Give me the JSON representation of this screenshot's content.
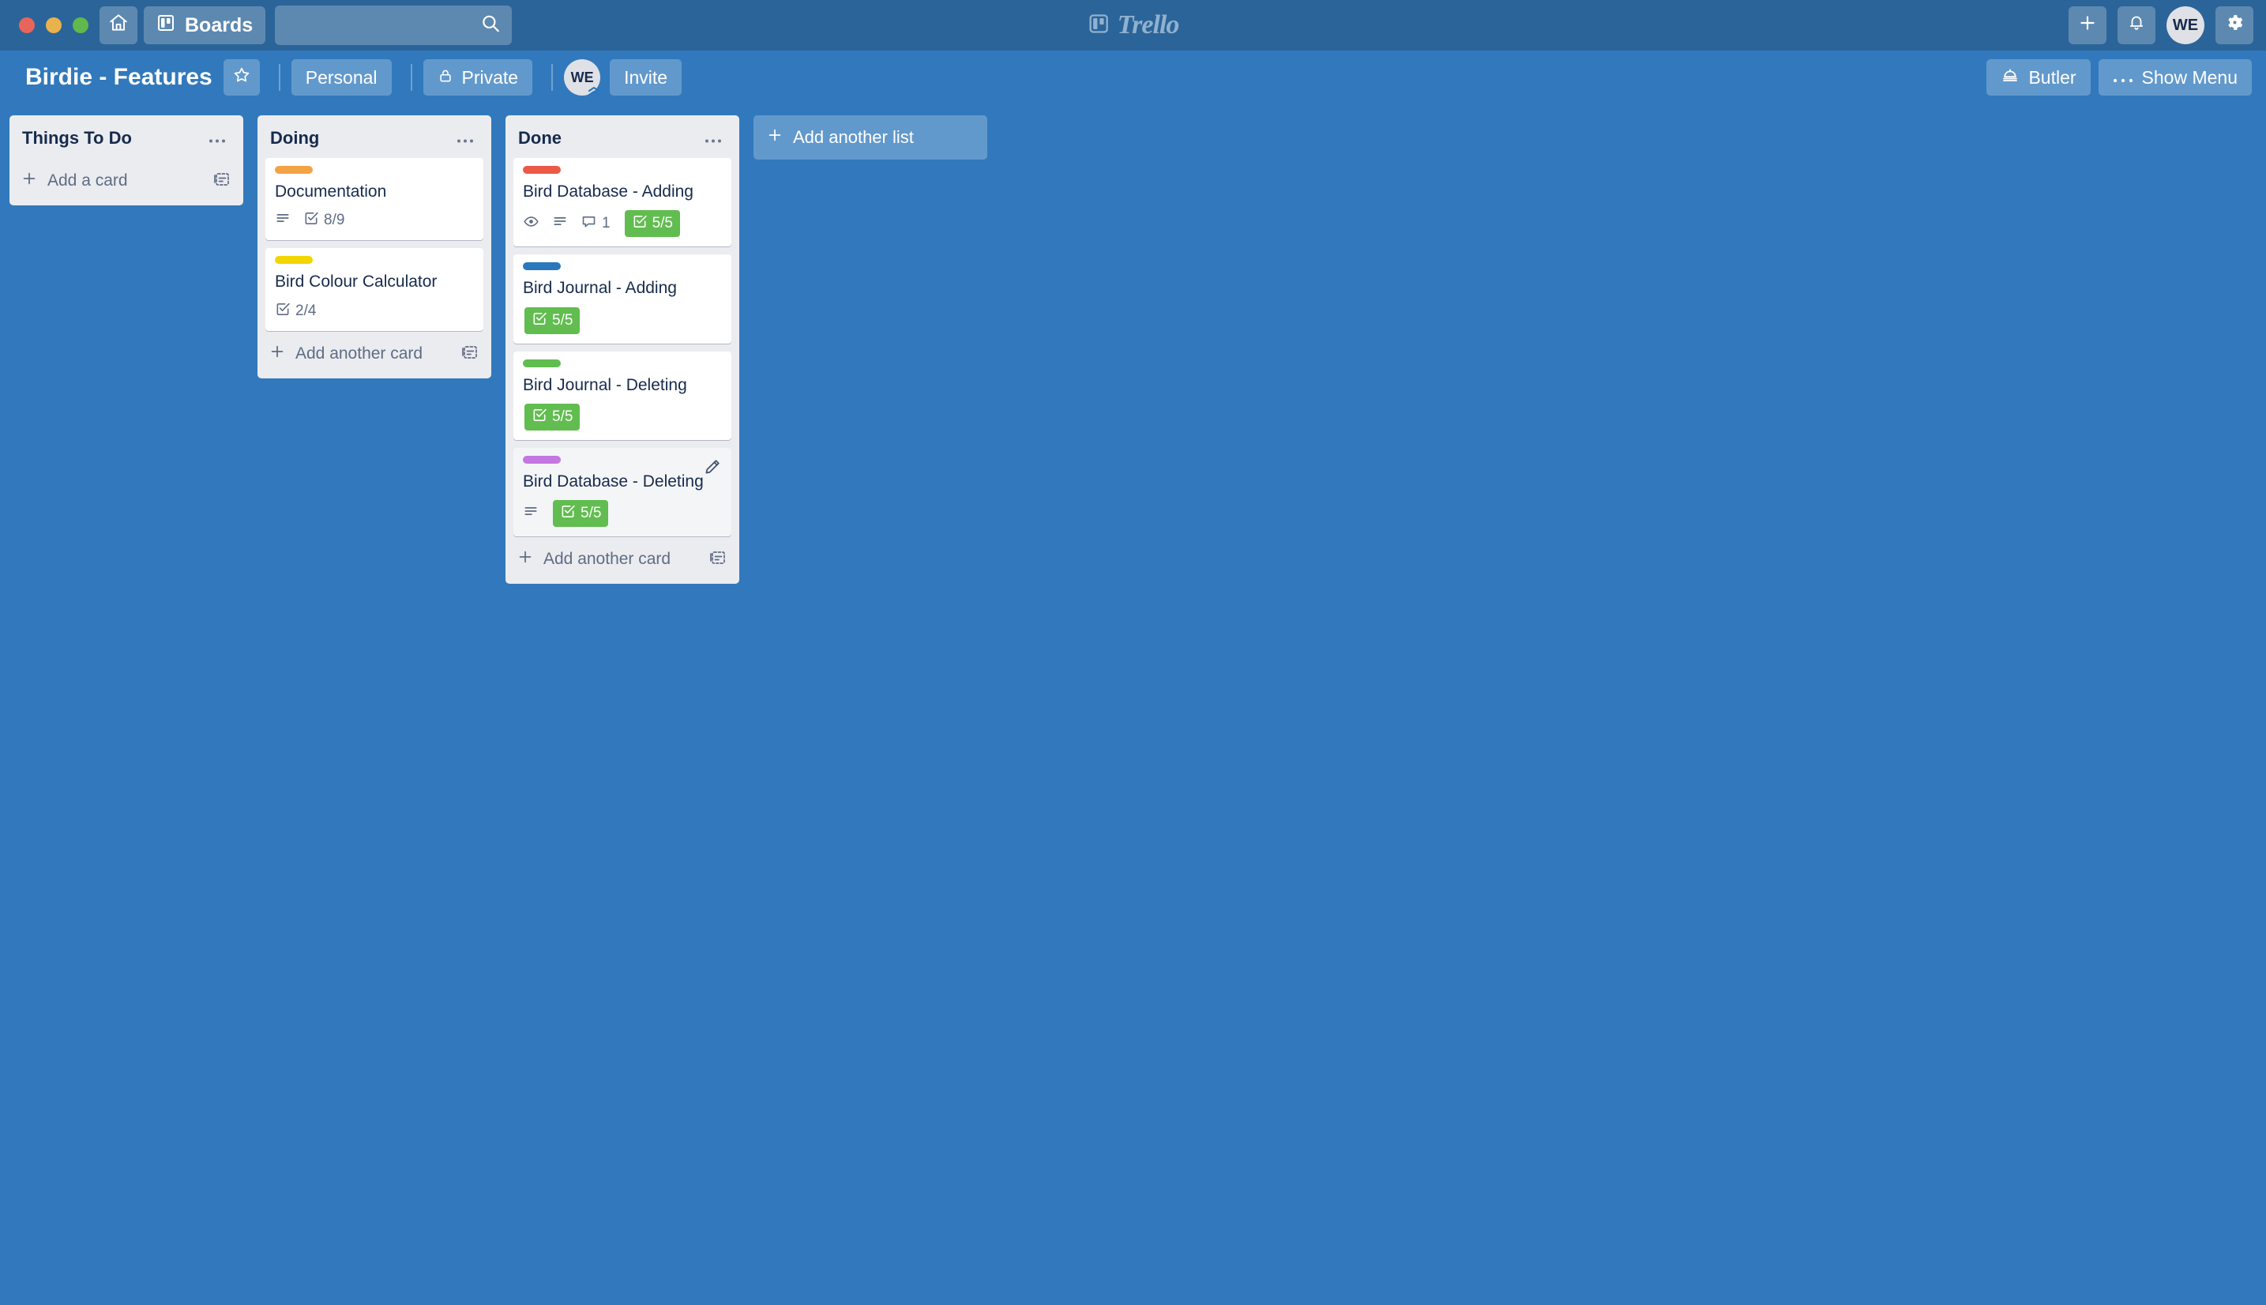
{
  "topbar": {
    "home_icon": "home-icon",
    "boards_label": "Boards",
    "boards_icon": "board-icon",
    "search": {
      "value": "",
      "placeholder": ""
    },
    "search_icon": "search-icon",
    "logo_text": "Trello",
    "logo_icon": "trello-board-icon",
    "add_icon": "plus-icon",
    "notifications_icon": "bell-icon",
    "avatar_initials": "WE",
    "settings_icon": "gear-icon"
  },
  "boardbar": {
    "title": "Birdie - Features",
    "star_icon": "star-icon",
    "team_label": "Personal",
    "visibility_label": "Private",
    "visibility_icon": "lock-icon",
    "member_initials": "WE",
    "invite_label": "Invite",
    "butler_label": "Butler",
    "butler_icon": "butler-bell-icon",
    "show_menu_label": "Show Menu",
    "show_menu_icon": "ellipsis-icon"
  },
  "canvas": {
    "add_list_label": "Add another list",
    "add_list_icon": "plus-icon",
    "lists": [
      {
        "title": "Things To Do",
        "menu_icon": "ellipsis-icon",
        "add_card_label": "Add a card",
        "add_card_icon": "plus-icon",
        "template_icon": "card-template-icon",
        "cards": []
      },
      {
        "title": "Doing",
        "menu_icon": "ellipsis-icon",
        "add_card_label": "Add another card",
        "add_card_icon": "plus-icon",
        "template_icon": "card-template-icon",
        "cards": [
          {
            "title": "Documentation",
            "label_color": "#f2a345",
            "hover": false,
            "badges": [
              {
                "kind": "description",
                "icon": "description-icon",
                "text": ""
              },
              {
                "kind": "checklist",
                "icon": "checklist-icon",
                "text": "8/9",
                "complete": false
              }
            ]
          },
          {
            "title": "Bird Colour Calculator",
            "label_color": "#f2d600",
            "hover": false,
            "badges": [
              {
                "kind": "checklist",
                "icon": "checklist-icon",
                "text": "2/4",
                "complete": false
              }
            ]
          }
        ]
      },
      {
        "title": "Done",
        "menu_icon": "ellipsis-icon",
        "add_card_label": "Add another card",
        "add_card_icon": "plus-icon",
        "template_icon": "card-template-icon",
        "cards": [
          {
            "title": "Bird Database - Adding",
            "label_color": "#eb5a46",
            "hover": false,
            "badges": [
              {
                "kind": "watch",
                "icon": "eye-icon",
                "text": ""
              },
              {
                "kind": "description",
                "icon": "description-icon",
                "text": ""
              },
              {
                "kind": "comments",
                "icon": "comment-icon",
                "text": "1"
              },
              {
                "kind": "checklist",
                "icon": "checklist-icon",
                "text": "5/5",
                "complete": true
              }
            ]
          },
          {
            "title": "Bird Journal - Adding",
            "label_color": "#2a77bd",
            "hover": false,
            "badges": [
              {
                "kind": "checklist",
                "icon": "checklist-icon",
                "text": "5/5",
                "complete": true
              }
            ]
          },
          {
            "title": "Bird Journal - Deleting",
            "label_color": "#61bd4f",
            "hover": false,
            "badges": [
              {
                "kind": "checklist",
                "icon": "checklist-icon",
                "text": "5/5",
                "complete": true
              }
            ]
          },
          {
            "title": "Bird Database - Deleting",
            "label_color": "#c377e0",
            "hover": true,
            "edit_icon": "pencil-icon",
            "badges": [
              {
                "kind": "description",
                "icon": "description-icon",
                "text": ""
              },
              {
                "kind": "checklist",
                "icon": "checklist-icon",
                "text": "5/5",
                "complete": true
              }
            ]
          }
        ]
      }
    ]
  },
  "colors": {
    "topbar_bg": "#2b6499",
    "board_bg": "#3179bc",
    "list_bg": "#ebecf0",
    "card_bg": "#ffffff",
    "text_dark": "#172b4d",
    "text_muted": "#5e6c84",
    "checklist_complete": "#61bd4f"
  }
}
